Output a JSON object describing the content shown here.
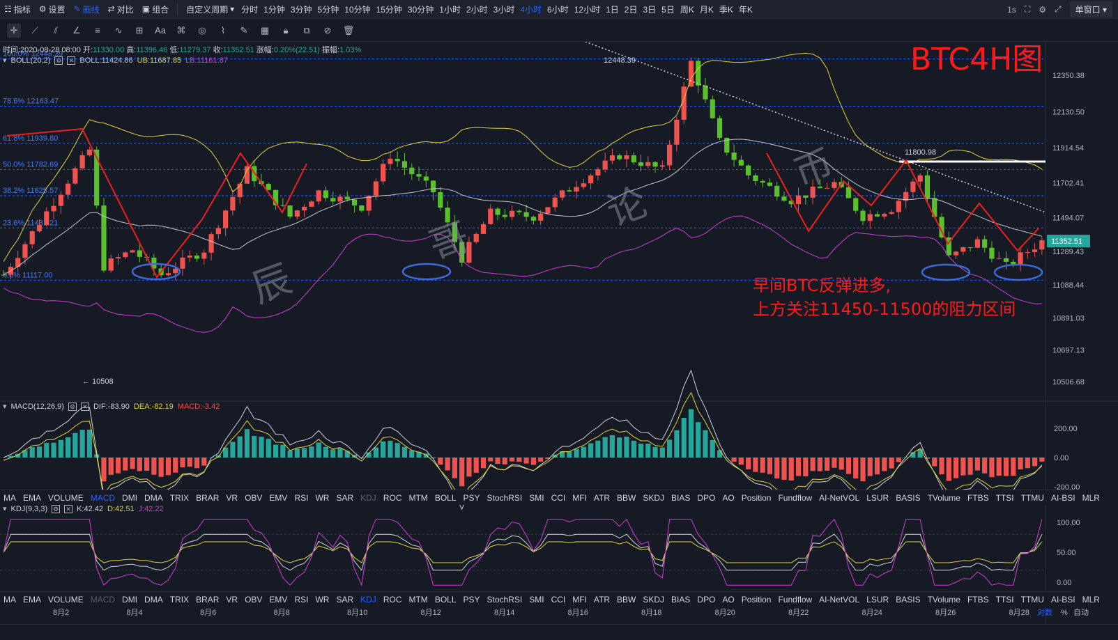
{
  "topbar": {
    "left_buttons": [
      {
        "icon": "indicator-icon",
        "label": "指标"
      },
      {
        "icon": "gear-icon",
        "label": "设置"
      },
      {
        "icon": "pen-icon",
        "label": "画线"
      },
      {
        "icon": "compare-icon",
        "label": "对比"
      },
      {
        "icon": "combo-icon",
        "label": "组合"
      }
    ],
    "custom_period": "自定义周期",
    "intervals": [
      "分时",
      "1分钟",
      "3分钟",
      "5分钟",
      "10分钟",
      "15分钟",
      "30分钟",
      "1小时",
      "2小时",
      "3小时",
      "4小时",
      "6小时",
      "12小时",
      "1日",
      "2日",
      "3日",
      "5日",
      "周K",
      "月K",
      "季K",
      "年K"
    ],
    "active_interval": "4小时",
    "right_label": "1s",
    "single_window": "单窗口"
  },
  "info": {
    "time_label": "时间:",
    "time": "2020-08-28 08:00",
    "open_label": "开:",
    "open": "11330.00",
    "high_label": "高:",
    "high": "11396.46",
    "low_label": "低:",
    "low": "11279.37",
    "close_label": "收:",
    "close": "11352.51",
    "chg_label": "涨幅:",
    "chg": "0.20%(22.51)",
    "amp_label": "振幅:",
    "amp": "1.03%"
  },
  "boll": {
    "name": "BOLL(20,2)",
    "boll": "BOLL:11424.86",
    "ub": "UB:11687.85",
    "lb": "LB:11161.87"
  },
  "macd": {
    "name": "MACD(12,26,9)",
    "dif": "DIF:-83.90",
    "dea": "DEA:-82.19",
    "macd": "MACD:-3.42"
  },
  "kdj": {
    "name": "KDJ(9,3,3)",
    "k": "K:42.42",
    "d": "D:42.51",
    "j": "J:42.22"
  },
  "fib_levels": [
    {
      "label": "100.0% 12448.39",
      "price": 12448.39
    },
    {
      "label": "78.6% 12163.47",
      "price": 12163.47
    },
    {
      "label": "61.8% 11939.80",
      "price": 11939.8
    },
    {
      "label": "50.0% 11782.69",
      "price": 11782.69
    },
    {
      "label": "38.2% 11625.57",
      "price": 11625.57
    },
    {
      "label": "23.6% 11431.21",
      "price": 11431.21
    },
    {
      "label": "0.0% 11117.00",
      "price": 11117.0
    }
  ],
  "price_axis": [
    "12350.38",
    "12130.50",
    "11914.54",
    "11702.41",
    "11494.07",
    "11289.43",
    "11088.44",
    "10891.03",
    "10697.13",
    "10506.68"
  ],
  "current_price": "11352.51",
  "macd_axis": [
    "200.00",
    "0.00",
    "-200.00"
  ],
  "kdj_axis": [
    "100.00",
    "50.00",
    "0.00"
  ],
  "annotations": {
    "title": "BTC4H图",
    "note_line1": "早间BTC反弹进多,",
    "note_line2": "上方关注11450-11500的阻力区间",
    "high_marker": "12448.39",
    "low_marker": "← 10508",
    "resistance": "11800.98",
    "watermark": [
      "辰",
      "哥",
      "论",
      "币"
    ]
  },
  "indicator_tabs": [
    "MA",
    "EMA",
    "VOLUME",
    "MACD",
    "DMI",
    "DMA",
    "TRIX",
    "BRAR",
    "VR",
    "OBV",
    "EMV",
    "RSI",
    "WR",
    "SAR",
    "KDJ",
    "ROC",
    "MTM",
    "BOLL",
    "PSY",
    "StochRSI",
    "SMI",
    "CCI",
    "MFI",
    "ATR",
    "BBW",
    "SKDJ",
    "BIAS",
    "DPO",
    "AO",
    "Position",
    "Fundflow",
    "AI-NetVOL",
    "LSUR",
    "BASIS",
    "TVolume",
    "FTBS",
    "TTSI",
    "TTMU",
    "AI-BSI",
    "MLR"
  ],
  "date_axis": [
    "8月2",
    "8月4",
    "8月6",
    "8月8",
    "8月10",
    "8月12",
    "8月14",
    "8月16",
    "8月18",
    "8月20",
    "8月22",
    "8月24",
    "8月26",
    "8月28"
  ],
  "bottom_right": [
    "对数",
    "%",
    "自动"
  ],
  "colors": {
    "up": "#ef5350",
    "down": "#26a69a",
    "boll_mid": "#c5c7ce",
    "boll_ub": "#e5d535",
    "boll_lb": "#d03fd3",
    "fib": "#2962ff",
    "accent": "#2962ff"
  }
}
